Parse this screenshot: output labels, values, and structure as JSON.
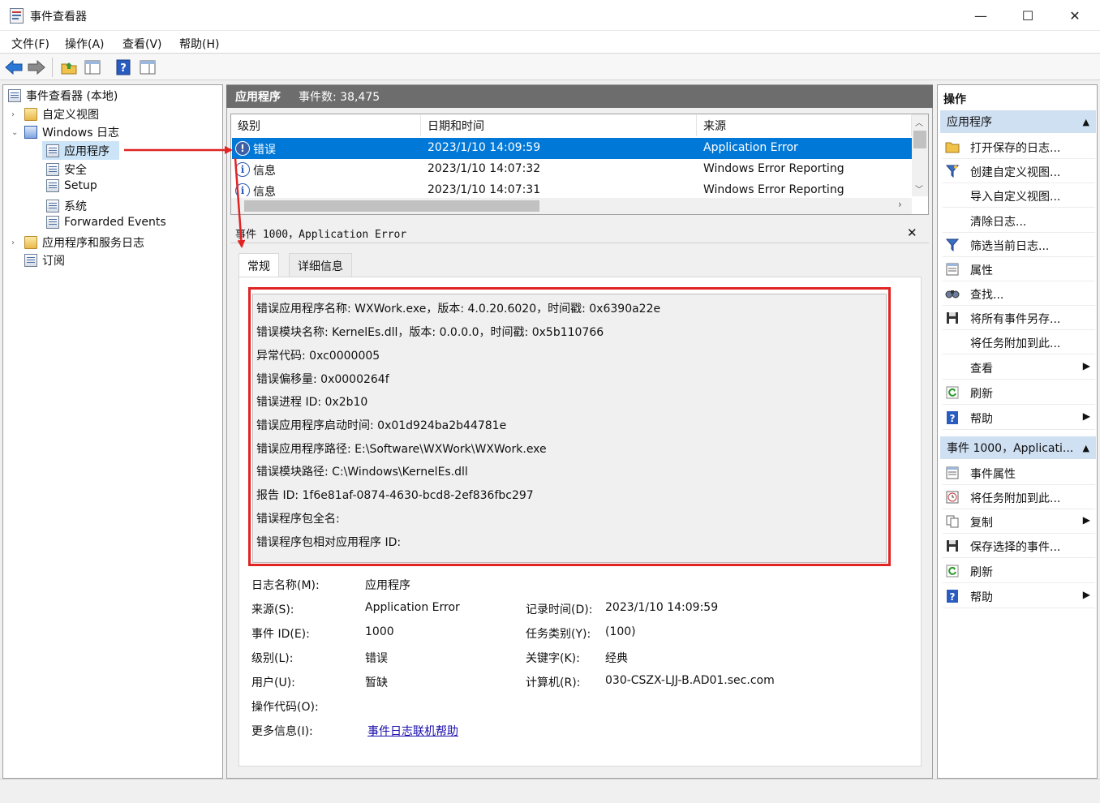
{
  "window": {
    "title": "事件查看器",
    "buttons": {
      "minimize": "—",
      "maximize": "☐",
      "close": "✕"
    }
  },
  "menu": [
    "文件(F)",
    "操作(A)",
    "查看(V)",
    "帮助(H)"
  ],
  "toolbar": [
    "back-icon",
    "forward-icon",
    "up-folder-icon",
    "show-hide-tree-icon",
    "help-icon",
    "properties-icon"
  ],
  "tree": {
    "root": "事件查看器 (本地)",
    "custom_views": "自定义视图",
    "windows_logs": "Windows 日志",
    "application": "应用程序",
    "security": "安全",
    "setup": "Setup",
    "system": "系统",
    "forwarded": "Forwarded Events",
    "app_service_logs": "应用程序和服务日志",
    "subscriptions": "订阅"
  },
  "log_header": {
    "name": "应用程序",
    "count": "事件数: 38,475"
  },
  "columns": {
    "level": "级别",
    "datetime": "日期和时间",
    "source": "来源"
  },
  "events": [
    {
      "level": "错误",
      "datetime": "2023/1/10 14:09:59",
      "source": "Application Error",
      "selected": true
    },
    {
      "level": "信息",
      "datetime": "2023/1/10 14:07:32",
      "source": "Windows Error Reporting",
      "selected": false
    },
    {
      "level": "信息",
      "datetime": "2023/1/10 14:07:31",
      "source": "Windows Error Reporting",
      "selected": false
    }
  ],
  "detail": {
    "title": "事件 1000，Application Error",
    "close": "✕",
    "tabs": {
      "general": "常规",
      "details": "详细信息"
    },
    "description": [
      "错误应用程序名称: WXWork.exe，版本: 4.0.20.6020，时间戳: 0x6390a22e",
      "错误模块名称: KernelEs.dll，版本: 0.0.0.0，时间戳: 0x5b110766",
      "异常代码: 0xc0000005",
      "错误偏移量: 0x0000264f",
      "错误进程 ID: 0x2b10",
      "错误应用程序启动时间: 0x01d924ba2b44781e",
      "错误应用程序路径: E:\\Software\\WXWork\\WXWork.exe",
      "错误模块路径: C:\\Windows\\KernelEs.dll",
      "报告 ID: 1f6e81af-0874-4630-bcd8-2ef836fbc297",
      "错误程序包全名:",
      "错误程序包相对应用程序 ID:"
    ],
    "props": {
      "log_name_label": "日志名称(M):",
      "log_name": "应用程序",
      "source_label": "来源(S):",
      "source": "Application Error",
      "logged_label": "记录时间(D):",
      "logged": "2023/1/10 14:09:59",
      "event_id_label": "事件 ID(E):",
      "event_id": "1000",
      "task_label": "任务类别(Y):",
      "task": "(100)",
      "level_label": "级别(L):",
      "level": "错误",
      "keywords_label": "关键字(K):",
      "keywords": "经典",
      "user_label": "用户(U):",
      "user": "暂缺",
      "computer_label": "计算机(R):",
      "computer": "030-CSZX-LJJ-B.AD01.sec.com",
      "opcode_label": "操作代码(O):",
      "more_info_label": "更多信息(I):",
      "more_info_link": "事件日志联机帮助"
    }
  },
  "actions": {
    "header": "操作",
    "section1": "应用程序",
    "section1_items": [
      {
        "label": "打开保存的日志...",
        "icon": "open-folder-icon",
        "submenu": false
      },
      {
        "label": "创建自定义视图...",
        "icon": "filter-icon",
        "submenu": false
      },
      {
        "label": "导入自定义视图...",
        "icon": "",
        "submenu": false
      },
      {
        "label": "清除日志...",
        "icon": "",
        "submenu": false
      },
      {
        "label": "筛选当前日志...",
        "icon": "filter-icon",
        "submenu": false
      },
      {
        "label": "属性",
        "icon": "properties-icon",
        "submenu": false
      },
      {
        "label": "查找...",
        "icon": "find-icon",
        "submenu": false
      },
      {
        "label": "将所有事件另存...",
        "icon": "save-icon",
        "submenu": false
      },
      {
        "label": "将任务附加到此...",
        "icon": "",
        "submenu": false
      },
      {
        "label": "查看",
        "icon": "",
        "submenu": true
      },
      {
        "label": "刷新",
        "icon": "refresh-icon",
        "submenu": false
      },
      {
        "label": "帮助",
        "icon": "help-icon",
        "submenu": true
      }
    ],
    "section2": "事件 1000，Applicati...",
    "section2_items": [
      {
        "label": "事件属性",
        "icon": "event-properties-icon",
        "submenu": false
      },
      {
        "label": "将任务附加到此...",
        "icon": "task-icon",
        "submenu": false
      },
      {
        "label": "复制",
        "icon": "copy-icon",
        "submenu": true
      },
      {
        "label": "保存选择的事件...",
        "icon": "save-icon",
        "submenu": false
      },
      {
        "label": "刷新",
        "icon": "refresh-icon",
        "submenu": false
      },
      {
        "label": "帮助",
        "icon": "help-icon",
        "submenu": true
      }
    ],
    "collapse_glyph": "▲",
    "submenu_glyph": "▶"
  },
  "colors": {
    "selection": "#0078d7",
    "annotation": "#e02424",
    "section_bg": "#cfe0f3",
    "header_bg": "#6d6d6d",
    "link": "#1a0dab"
  }
}
